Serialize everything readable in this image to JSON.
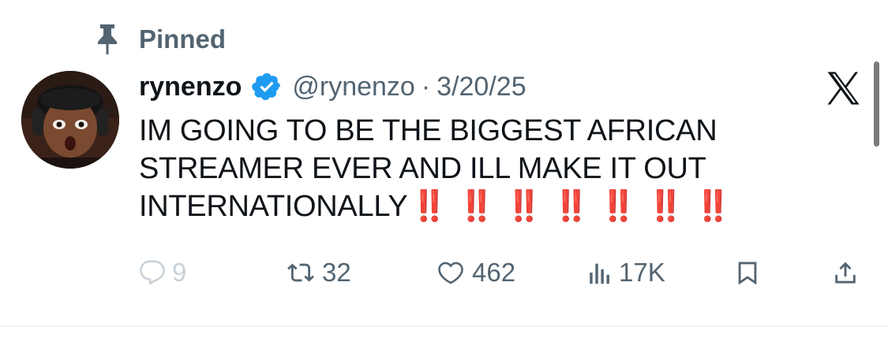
{
  "pinned": {
    "label": "Pinned",
    "icon": "pin-icon"
  },
  "tweet": {
    "display_name": "rynenzo",
    "verified_icon": "verified-badge-icon",
    "handle": "@rynenzo",
    "separator": "·",
    "date": "3/20/25",
    "text": "IM GOING TO BE THE BIGGEST AFRICAN STREAMER EVER AND ILL MAKE IT OUT INTERNATIONALLY",
    "emphasis": "‼️ ‼️ ‼️ ‼️ ‼️ ‼️ ‼️"
  },
  "actions": {
    "replies": "9",
    "reposts": "32",
    "likes": "462",
    "views": "17K"
  },
  "colors": {
    "text": "#0f1419",
    "secondary": "#536471",
    "verified": "#1d9bf0",
    "emphasis": "#e0201b"
  }
}
